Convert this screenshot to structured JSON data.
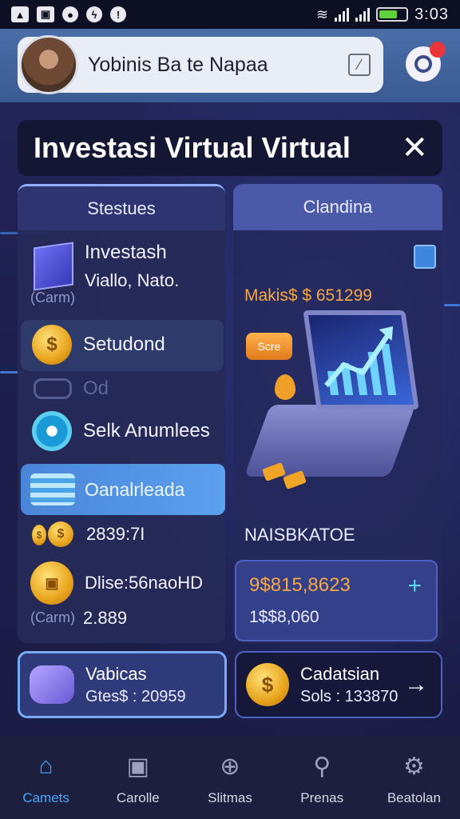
{
  "status_bar": {
    "left_icons": [
      "image-icon",
      "gallery-icon",
      "data-saver-icon",
      "messenger-icon",
      "alert-icon"
    ],
    "time": "3:03"
  },
  "header": {
    "user_name": "Yobinis Ba te Napaa",
    "edit_icon": "edit-icon",
    "chat_icon": "chat-icon"
  },
  "title": {
    "text": "Investasi Virtual Virtual",
    "close_label": "✕"
  },
  "left_panel": {
    "heading": "Stestues",
    "items": [
      {
        "title": "Investash",
        "subtitle": "Viallo, Nato.",
        "caption": "(Carm)"
      },
      {
        "title": "Setudond"
      },
      {
        "title": "Od"
      },
      {
        "title": "Selk Anumlees"
      },
      {
        "title": "Oanalrleada"
      },
      {
        "title": "2839:7I"
      },
      {
        "title": "Dlise:56naoHD",
        "caption": "(Carm)",
        "value": "2.889"
      }
    ]
  },
  "right_panel": {
    "heading": "Clandina",
    "price": "Makis$ $ 651299",
    "chip": "Scre",
    "section_label": "NAISBKATOE",
    "value_main": "9$815,8623",
    "value_sub": "1$$8,060",
    "plus": "+"
  },
  "bottom_cards": [
    {
      "title": "Vabicas",
      "value": "Gtes$ : 20959"
    },
    {
      "title": "Cadatsian",
      "value": "Sols : 133870",
      "arrow": "→"
    }
  ],
  "nav": [
    {
      "label": "Camets",
      "icon": "home-icon",
      "active": true
    },
    {
      "label": "Carolle",
      "icon": "camera-icon",
      "active": false
    },
    {
      "label": "Slitmas",
      "icon": "search-plus-icon",
      "active": false
    },
    {
      "label": "Prenas",
      "icon": "search-icon",
      "active": false
    },
    {
      "label": "Beatolan",
      "icon": "settings-frame-icon",
      "active": false
    }
  ],
  "colors": {
    "accent": "#3b9cf2",
    "orange": "#f7a844",
    "background": "#1d1f4a"
  }
}
